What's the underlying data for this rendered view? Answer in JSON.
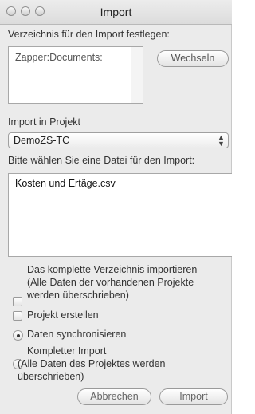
{
  "window": {
    "title": "Import"
  },
  "directory": {
    "heading": "Verzeichnis für den Import festlegen:",
    "path": "Zapper:Documents:",
    "change_button": "Wechseln"
  },
  "project": {
    "label": "Import in Projekt",
    "selected": "DemoZS-TC"
  },
  "file": {
    "heading": "Bitte wählen Sie eine Datei für den Import:",
    "items": [
      "Kosten und Ertäge.csv"
    ]
  },
  "options": {
    "import_all_line1": "Das komplette Verzeichnis importieren",
    "import_all_line2": "(Alle Daten der vorhandenen Projekte",
    "import_all_line3": "werden überschrieben)",
    "create_project": "Projekt erstellen",
    "sync_data": "Daten synchronisieren",
    "full_import_line1": "Kompletter Import",
    "full_import_line2": "(Alle Daten des Projektes werden",
    "full_import_line3": "überschrieben)"
  },
  "buttons": {
    "cancel": "Abbrechen",
    "import": "Import"
  }
}
